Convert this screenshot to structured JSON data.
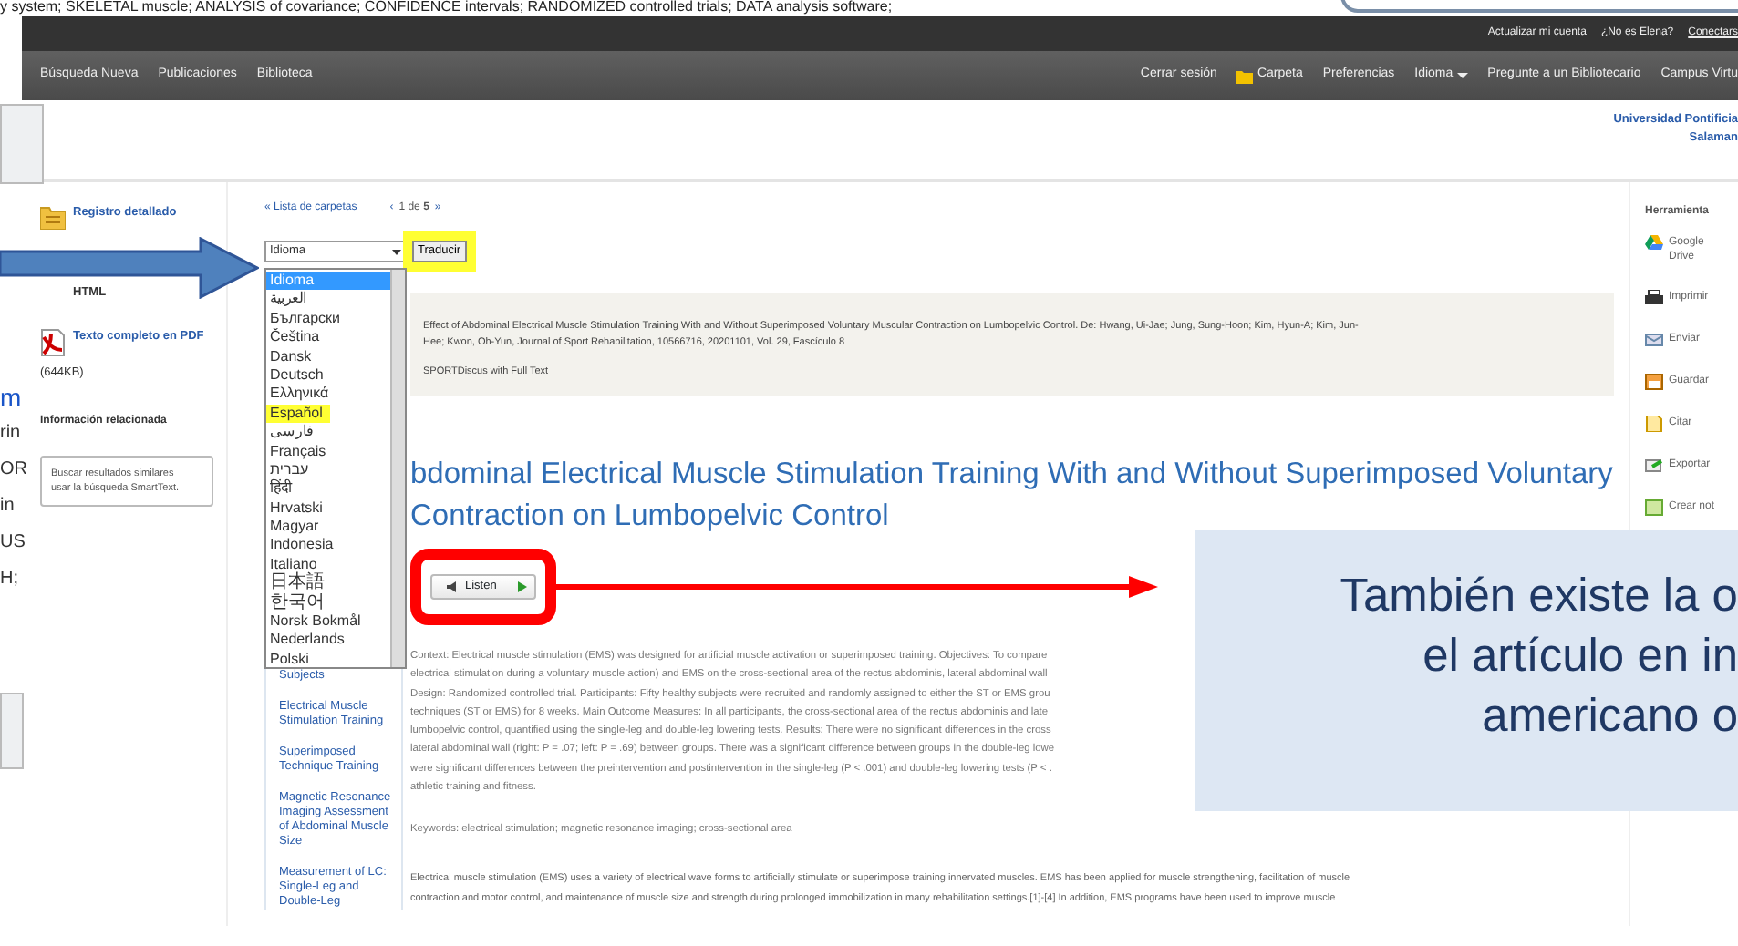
{
  "top_fragment": "y system; SKELETAL muscle; ANALYSIS of covariance; CONFIDENCE intervals; RANDOMIZED controlled trials; DATA analysis software;",
  "top_links": [
    "Actualizar mi cuenta",
    "¿No es Elena?",
    "Conectars"
  ],
  "nav_left": [
    "Búsqueda Nueva",
    "Publicaciones",
    "Biblioteca"
  ],
  "nav_right": [
    {
      "label": "Cerrar sesión",
      "kind": "link"
    },
    {
      "label": "Carpeta",
      "kind": "folder"
    },
    {
      "label": "Preferencias",
      "kind": "link"
    },
    {
      "label": "Idioma",
      "kind": "menu"
    },
    {
      "label": "Pregunte a un Bibliotecario",
      "kind": "link"
    },
    {
      "label": "Campus Virtu",
      "kind": "link"
    }
  ],
  "institution": [
    "Universidad Pontificia",
    "Salaman"
  ],
  "left_fragments": [
    {
      "text": "m",
      "kind": "link"
    },
    {
      "text": "rin",
      "kind": "text"
    },
    {
      "text": "OR",
      "kind": "text"
    },
    {
      "text": "in",
      "kind": "text"
    },
    {
      "text": "US",
      "kind": "text"
    },
    {
      "text": "H;",
      "kind": "text"
    }
  ],
  "sidebar": {
    "links": [
      {
        "label": "Registro detallado",
        "kind": "record"
      },
      {
        "label": "HTML",
        "kind": "html"
      },
      {
        "label": "Texto completo en PDF",
        "kind": "pdf",
        "size": "(644KB)"
      }
    ],
    "related_heading": "Información relacionada",
    "related_box": {
      "title": "Buscar resultados similares",
      "subtitle": "usar la búsqueda SmartText."
    }
  },
  "pager": {
    "back": "« Lista de carpetas",
    "prev": "‹",
    "text": "1 de **5**",
    "next": "»"
  },
  "translate": {
    "select_value": "Idioma",
    "button": "Traducir",
    "button_highlighted": true,
    "options": [
      {
        "label": "Idioma",
        "selected": true,
        "highlighted": false
      },
      {
        "label": "العربية",
        "selected": false,
        "highlighted": false
      },
      {
        "label": "Български",
        "selected": false,
        "highlighted": false
      },
      {
        "label": "Čeština",
        "selected": false,
        "highlighted": false
      },
      {
        "label": "Dansk",
        "selected": false,
        "highlighted": false
      },
      {
        "label": "Deutsch",
        "selected": false,
        "highlighted": false
      },
      {
        "label": "Ελληνικά",
        "selected": false,
        "highlighted": false
      },
      {
        "label": "Español",
        "selected": false,
        "highlighted": true
      },
      {
        "label": "فارسی",
        "selected": false,
        "highlighted": false
      },
      {
        "label": "Français",
        "selected": false,
        "highlighted": false
      },
      {
        "label": "עברית",
        "selected": false,
        "highlighted": false
      },
      {
        "label": "हिंदी",
        "selected": false,
        "highlighted": false
      },
      {
        "label": "Hrvatski",
        "selected": false,
        "highlighted": false
      },
      {
        "label": "Magyar",
        "selected": false,
        "highlighted": false
      },
      {
        "label": "Indonesia",
        "selected": false,
        "highlighted": false
      },
      {
        "label": "Italiano",
        "selected": false,
        "highlighted": false
      },
      {
        "label": "日本語",
        "selected": false,
        "highlighted": false
      },
      {
        "label": "한국어",
        "selected": false,
        "highlighted": false
      },
      {
        "label": "Norsk Bokmål",
        "selected": false,
        "highlighted": false
      },
      {
        "label": "Nederlands",
        "selected": false,
        "highlighted": false
      },
      {
        "label": "Polski",
        "selected": false,
        "highlighted": false
      }
    ]
  },
  "citation": {
    "lines": [
      "Effect of Abdominal Electrical Muscle Stimulation Training With and Without Superimposed Voluntary Muscular Contraction on Lumbopelvic Control. De: Hwang, Ui-Jae; Jung, Sung-Hoon; Kim, Hyun-A; Kim, Jun-",
      "Hee; Kwon, Oh-Yun, Journal of Sport Rehabilitation, 10566716, 20201101, Vol. 29, Fascículo 8"
    ],
    "database": "SPORTDiscus with Full Text"
  },
  "subjects": [
    "Subjects",
    "Electrical Muscle Stimulation Training",
    "Superimposed Technique Training",
    "Magnetic Resonance Imaging Assessment of Abdominal Muscle Size",
    "Measurement of LC: Single-Leg and Double-Leg"
  ],
  "article": {
    "title_lines": [
      "bdominal Electrical Muscle Stimulation Training With and Without Superimposed Voluntary",
      "Contraction on Lumbopelvic Control"
    ],
    "listen": "Listen",
    "abstract_lines": [
      "Context: Electrical muscle stimulation (EMS) was designed for artificial muscle activation or superimposed training. Objectives: To compare",
      "electrical stimulation during a voluntary muscle action) and EMS on the cross-sectional area of the rectus abdominis, lateral abdominal wall",
      "Design: Randomized controlled trial. Participants: Fifty healthy subjects were recruited and randomly assigned to either the ST or EMS grou",
      "techniques (ST or EMS) for 8 weeks. Main Outcome Measures: In all participants, the cross-sectional area of the rectus abdominis and late",
      "lumbopelvic control, quantified using the single-leg and double-leg lowering tests. Results: There were no significant differences in the cross",
      "lateral abdominal wall (right: P = .07; left: P = .69) between groups. There was a significant difference between groups in the double-leg lowe",
      "were significant differences between the preintervention and postintervention in the single-leg (P < .001) and double-leg lowering tests (P < .",
      "athletic training and fitness."
    ],
    "keywords": "Keywords: electrical stimulation; magnetic resonance imaging; cross-sectional area",
    "body_lines": [
      "Electrical muscle stimulation (EMS) uses a variety of electrical wave forms to artificially stimulate or superimpose training innervated muscles. EMS has been applied for muscle strengthening, facilitation of muscle",
      "contraction and motor control, and maintenance of muscle size and strength during prolonged immobilization in many rehabilitation settings.[1]-[4] In addition, EMS programs have been used to improve muscle"
    ]
  },
  "tools": {
    "heading": "Herramienta",
    "items": [
      {
        "label": "Google Drive",
        "kind": "drive"
      },
      {
        "label": "Imprimir",
        "kind": "print"
      },
      {
        "label": "Enviar",
        "kind": "mail"
      },
      {
        "label": "Guardar",
        "kind": "save"
      },
      {
        "label": "Citar",
        "kind": "cite"
      },
      {
        "label": "Exportar",
        "kind": "export"
      },
      {
        "label": "Crear not",
        "kind": "note"
      }
    ]
  },
  "callout": {
    "lines": [
      "También existe la o",
      "el artículo en in",
      "americano o"
    ]
  }
}
